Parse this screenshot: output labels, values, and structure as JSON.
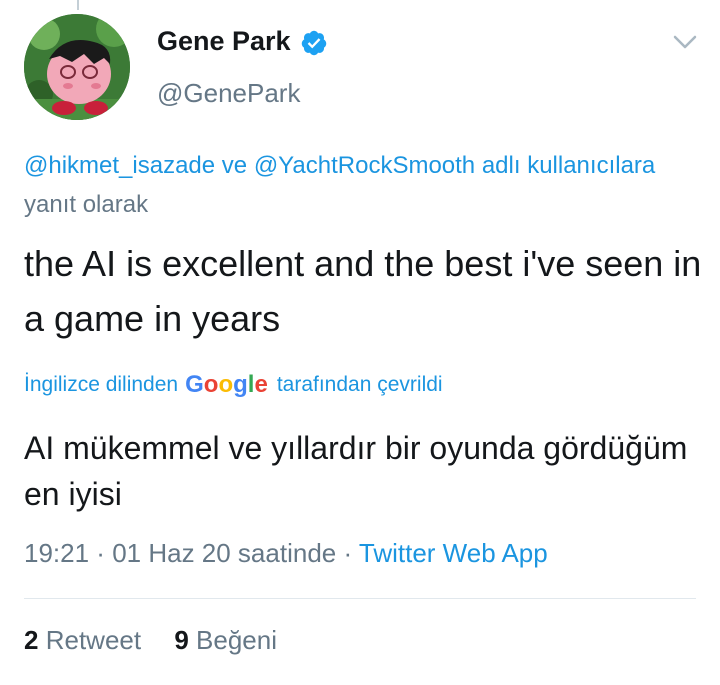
{
  "tweet": {
    "author": {
      "name": "Gene Park",
      "handle": "@GenePark",
      "verified": true
    },
    "reply_context": {
      "mention_1": "@hikmet_isazade",
      "connector": " ve ",
      "mention_2": "@YachtRockSmooth",
      "suffix_link": " adlı kullanıcılara",
      "suffix_text": " yanıt olarak"
    },
    "text": "the AI is excellent and the best i've seen in a game in years",
    "translation": {
      "prefix": "İngilizce dilinden",
      "provider": "Google",
      "suffix": "tarafından çevrildi",
      "text": "AI mükemmel ve yıllardır bir oyunda gördüğüm en iyisi"
    },
    "meta": {
      "time": "19:21",
      "date": "01 Haz 20 saatinde",
      "separator": " · ",
      "app": "Twitter Web App"
    },
    "stats": {
      "retweets_count": "2",
      "retweets_label": "Retweet",
      "likes_count": "9",
      "likes_label": "Beğeni"
    }
  },
  "colors": {
    "link": "#1b95e0",
    "secondary_text": "#657786",
    "primary_text": "#14171a",
    "verified_badge": "#1da1f2",
    "divider": "#e1e8ed"
  },
  "icons": {
    "verified": "verified-badge-icon",
    "caret": "chevron-down-icon"
  }
}
